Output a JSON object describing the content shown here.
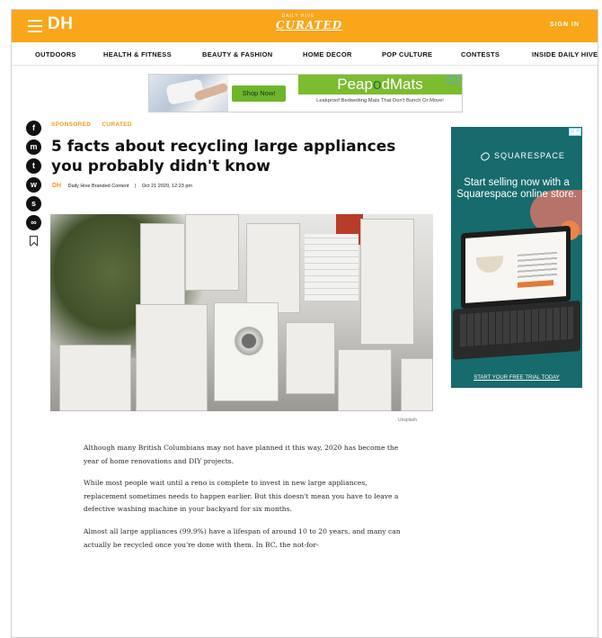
{
  "header": {
    "logo": "DH",
    "curated_small": "DAILY HIVE",
    "curated": "CURATED",
    "sign_in": "SIGN IN"
  },
  "nav": {
    "items": [
      "OUTDOORS",
      "HEALTH & FITNESS",
      "BEAUTY & FASHION",
      "HOME DECOR",
      "POP CULTURE",
      "CONTESTS",
      "INSIDE DAILY HIVE"
    ]
  },
  "top_ad": {
    "shop_now": "Shop Now!",
    "brand_pre": "Peap",
    "brand_o": "o",
    "brand_post": "dMats",
    "tagline": "Leakproof Bedwetting Mats That Don't Bunch Or Move!",
    "ad_badge": "D X"
  },
  "share": {
    "facebook": "f",
    "messenger": "m",
    "twitter": "t",
    "whatsapp": "w",
    "sms": "s",
    "link": "∞"
  },
  "article": {
    "tags": [
      "SPONSORED",
      "CURATED"
    ],
    "title": "5 facts about recycling large appliances you probably didn't know",
    "byline_logo": "DH",
    "author": "Daily Hive Branded Content",
    "separator": "|",
    "date": "Oct 21 2020, 12:23 pm",
    "image_credit": "Unsplash",
    "paragraphs": [
      "Although many British Columbians may not have planned it this way, 2020 has become the year of home renovations and DIY projects.",
      "While most people wait until a reno is complete to invest in new large appliances, replacement sometimes needs to happen earlier. But this doesn't mean you have to leave a defective washing machine in your backyard for six months.",
      "Almost all large appliances (99.9%) have a lifespan of around 10 to 20 years, and many can actually be recycled once you're done with them. In BC, the not-for-"
    ]
  },
  "side_ad": {
    "brand": "SQUARESPACE",
    "headline": "Start selling now with a Squarespace online store.",
    "cta": "START YOUR FREE TRIAL TODAY",
    "ad_badge": "D X"
  },
  "colors": {
    "brand_orange": "#f9a61a",
    "ad_green": "#7cbc2f",
    "squarespace_teal": "#176b6c"
  }
}
